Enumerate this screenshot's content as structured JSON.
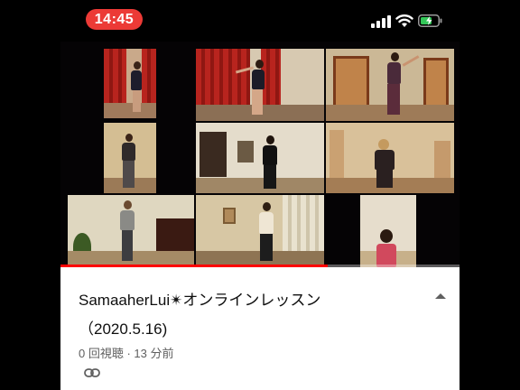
{
  "status_bar": {
    "time": "14:45"
  },
  "video": {
    "progress_fraction": 0.67,
    "accent_color": "#ff0000"
  },
  "info": {
    "title_line1": "SamaaherLui✴オンラインレッスン",
    "title_line2": "（2020.5.16)",
    "meta": "0 回視聴 · 13 分前",
    "icons": [
      "collapse-chevron-icon",
      "link-icon"
    ]
  }
}
